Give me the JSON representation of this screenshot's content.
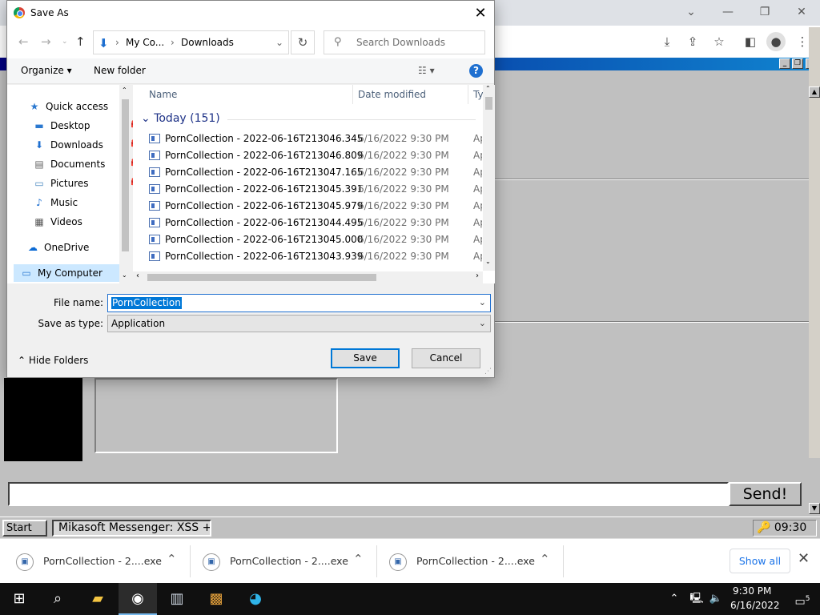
{
  "chrome": {
    "window_controls": {
      "minimize": "—",
      "restore": "❐",
      "close": "✕",
      "tabs_menu": "⌄"
    }
  },
  "dialog": {
    "title": "Save As",
    "breadcrumb": [
      "My Co...",
      "Downloads"
    ],
    "search_placeholder": "Search Downloads",
    "commands": {
      "organize": "Organize ▾",
      "new_folder": "New folder",
      "view": "☷ ▾",
      "help": "?"
    },
    "nav": [
      {
        "label": "Quick access",
        "icon": "star-icon",
        "glyph": "★",
        "color": "#2b79d0",
        "pinned": false
      },
      {
        "label": "Desktop",
        "icon": "desktop-icon",
        "glyph": "▬",
        "color": "#2b79d0",
        "pinned": true
      },
      {
        "label": "Downloads",
        "icon": "downloads-icon",
        "glyph": "⬇",
        "color": "#1e6fd0",
        "pinned": true
      },
      {
        "label": "Documents",
        "icon": "documents-icon",
        "glyph": "▤",
        "color": "#666",
        "pinned": true
      },
      {
        "label": "Pictures",
        "icon": "pictures-icon",
        "glyph": "▭",
        "color": "#4a88c0",
        "pinned": true
      },
      {
        "label": "Music",
        "icon": "music-icon",
        "glyph": "♪",
        "color": "#1e6fd0",
        "pinned": false
      },
      {
        "label": "Videos",
        "icon": "videos-icon",
        "glyph": "▦",
        "color": "#555",
        "pinned": false
      },
      {
        "label": "OneDrive",
        "icon": "onedrive-icon",
        "glyph": "☁",
        "color": "#0b6ad4",
        "pinned": false
      },
      {
        "label": "My Computer",
        "icon": "computer-icon",
        "glyph": "▭",
        "color": "#2b79d0",
        "pinned": false,
        "selected": true
      }
    ],
    "columns": {
      "name": "Name",
      "date": "Date modified",
      "type": "Ty"
    },
    "group": "Today (151)",
    "files": [
      {
        "name": "PornCollection - 2022-06-16T213046.345",
        "date": "6/16/2022 9:30 PM",
        "type": "Ap"
      },
      {
        "name": "PornCollection - 2022-06-16T213046.809",
        "date": "6/16/2022 9:30 PM",
        "type": "Ap"
      },
      {
        "name": "PornCollection - 2022-06-16T213047.165",
        "date": "6/16/2022 9:30 PM",
        "type": "Ap"
      },
      {
        "name": "PornCollection - 2022-06-16T213045.391",
        "date": "6/16/2022 9:30 PM",
        "type": "Ap"
      },
      {
        "name": "PornCollection - 2022-06-16T213045.979",
        "date": "6/16/2022 9:30 PM",
        "type": "Ap"
      },
      {
        "name": "PornCollection - 2022-06-16T213044.495",
        "date": "6/16/2022 9:30 PM",
        "type": "Ap"
      },
      {
        "name": "PornCollection - 2022-06-16T213045.000",
        "date": "6/16/2022 9:30 PM",
        "type": "Ap"
      },
      {
        "name": "PornCollection - 2022-06-16T213043.939",
        "date": "6/16/2022 9:30 PM",
        "type": "Ap"
      }
    ],
    "file_name_label": "File name:",
    "file_name_value": "PornCollection",
    "save_type_label": "Save as type:",
    "save_type_value": "Application",
    "hide_folders": "Hide Folders",
    "save_button": "Save",
    "cancel_button": "Cancel"
  },
  "app": {
    "send_button": "Send!",
    "retro_start": "Start",
    "retro_task": "Mikasoft Messenger: XSS +",
    "retro_clock": "09:30"
  },
  "downloads": {
    "items": [
      {
        "name": "PornCollection - 2....exe"
      },
      {
        "name": "PornCollection - 2....exe"
      },
      {
        "name": "PornCollection - 2....exe"
      }
    ],
    "show_all": "Show all"
  },
  "taskbar": {
    "time": "9:30 PM",
    "date": "6/16/2022",
    "notifications": "5"
  }
}
